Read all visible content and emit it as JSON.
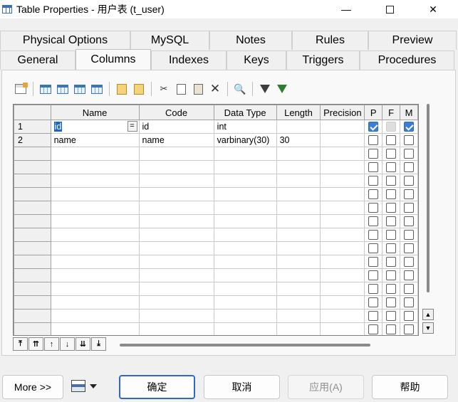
{
  "window": {
    "title": "Table Properties - 用户表 (t_user)",
    "minimize_glyph": "—",
    "close_glyph": "✕"
  },
  "tabs": {
    "row1": [
      "Physical Options",
      "MySQL",
      "Notes",
      "Rules",
      "Preview"
    ],
    "row2": [
      "General",
      "Columns",
      "Indexes",
      "Keys",
      "Triggers",
      "Procedures"
    ],
    "active": "Columns"
  },
  "toolbar": {
    "buttons": [
      "properties-icon",
      "add-row-icon",
      "insert-row-icon",
      "add-columns-icon",
      "replace-icon",
      "new-note-icon",
      "paste-note-icon",
      "cut-icon",
      "copy-icon",
      "paste-icon",
      "delete-icon",
      "find-icon",
      "filter-icon",
      "clear-filter-icon"
    ],
    "cut_glyph": "✂",
    "copy_glyph": "⎘",
    "delete_glyph": "✕",
    "find_glyph": "🔍"
  },
  "grid": {
    "columns": [
      "Name",
      "Code",
      "Data Type",
      "Length",
      "Precision",
      "P",
      "F",
      "M"
    ],
    "rows": [
      {
        "num": "1",
        "name": "id",
        "code": "id",
        "datatype": "int",
        "length": "",
        "precision": "",
        "p": true,
        "f": false,
        "m": true
      },
      {
        "num": "2",
        "name": "name",
        "code": "name",
        "datatype": "varbinary(30)",
        "length": "30",
        "precision": "",
        "p": false,
        "f": false,
        "m": false
      }
    ],
    "empty_rows": 14,
    "eq_button": "="
  },
  "scroll": {
    "up_glyph": "▲",
    "down_glyph": "▼"
  },
  "gridnav": {
    "buttons": [
      "⤒",
      "⇈",
      "↑",
      "↓",
      "⇊",
      "⤓"
    ]
  },
  "footer": {
    "more": "More >>",
    "ok": "确定",
    "cancel": "取消",
    "apply": "应用(A)",
    "help": "帮助"
  }
}
